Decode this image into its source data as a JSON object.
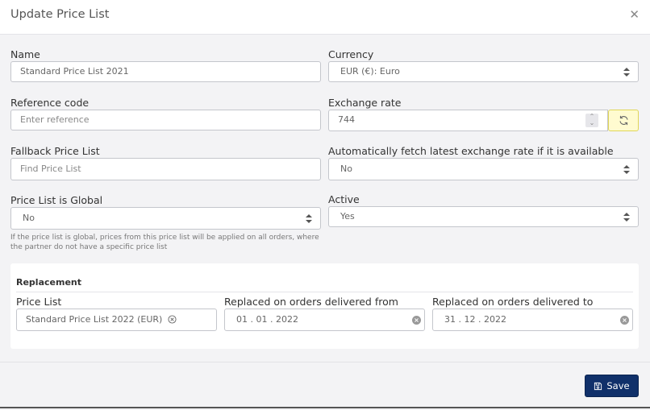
{
  "dialog": {
    "title": "Update Price List",
    "close_icon": "close-icon"
  },
  "form": {
    "name": {
      "label": "Name",
      "value": "Standard Price List 2021"
    },
    "currency": {
      "label": "Currency",
      "value": "EUR (€): Euro"
    },
    "reference_code": {
      "label": "Reference code",
      "placeholder": "Enter reference",
      "value": ""
    },
    "exchange_rate": {
      "label": "Exchange rate",
      "value": "744",
      "refresh_icon": "refresh-icon"
    },
    "fallback_price_list": {
      "label": "Fallback Price List",
      "placeholder": "Find Price List",
      "value": ""
    },
    "auto_fetch": {
      "label": "Automatically fetch latest exchange rate if it is available",
      "value": "No"
    },
    "is_global": {
      "label": "Price List is Global",
      "value": "No",
      "help": "If the price list is global, prices from this price list will be applied on all orders, where the partner do not have a specific price list"
    },
    "active": {
      "label": "Active",
      "value": "Yes"
    }
  },
  "replacement": {
    "title": "Replacement",
    "price_list": {
      "label": "Price List",
      "value": "Standard Price List 2022 (EUR)"
    },
    "from": {
      "label": "Replaced on orders delivered from",
      "value": "01 . 01 . 2022"
    },
    "to": {
      "label": "Replaced on orders delivered to",
      "value": "31 . 12 . 2022"
    }
  },
  "footer": {
    "save_label": "Save",
    "save_icon": "floppy-disk-icon"
  },
  "colors": {
    "primary": "#10306a",
    "refresh_bg": "#fffbd0",
    "refresh_border": "#e0d658"
  }
}
